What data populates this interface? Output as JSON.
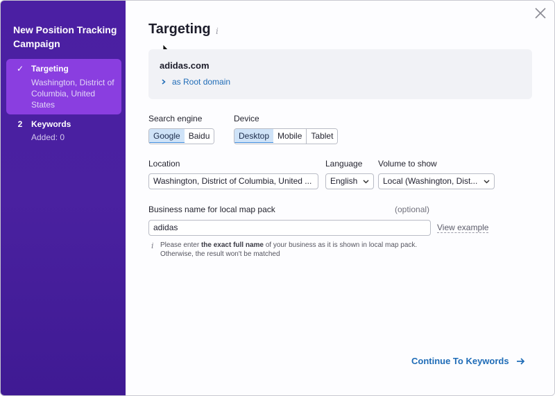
{
  "sidebar": {
    "title": "New Position Tracking Campaign",
    "steps": [
      {
        "marker": "✓",
        "label": "Targeting",
        "sub": "Washington, District of Columbia, United States"
      },
      {
        "marker": "2",
        "label": "Keywords",
        "sub": "Added: 0"
      }
    ]
  },
  "main": {
    "title": "Targeting",
    "title_info": "i",
    "domain": {
      "name": "adidas.com",
      "type": "as Root domain"
    },
    "search_engine": {
      "label": "Search engine",
      "options": [
        "Google",
        "Baidu"
      ],
      "selected": "Google"
    },
    "device": {
      "label": "Device",
      "options": [
        "Desktop",
        "Mobile",
        "Tablet"
      ],
      "selected": "Desktop"
    },
    "location": {
      "label": "Location",
      "value": "Washington, District of Columbia, United ..."
    },
    "language": {
      "label": "Language",
      "value": "English"
    },
    "volume": {
      "label": "Volume to show",
      "value": "Local (Washington, Dist..."
    },
    "business": {
      "label": "Business name for local map pack",
      "optional": "(optional)",
      "value": "adidas",
      "view_example": "View example",
      "note_icon": "i",
      "note_prefix": "Please enter ",
      "note_bold": "the exact full name",
      "note_suffix": " of your business as it is shown in local map pack.",
      "note_line2": "Otherwise, the result won't be matched"
    },
    "continue_label": "Continue To Keywords"
  },
  "colors": {
    "sidebar_bg": "#4b1fa3",
    "active_step_bg": "#8a3ee0",
    "link": "#1f6cb7",
    "selected_bg": "#cfe3f8",
    "selected_border": "#3d8adb"
  }
}
